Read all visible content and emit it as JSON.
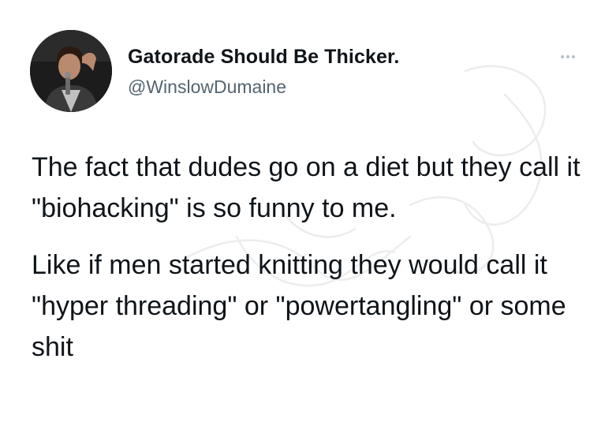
{
  "tweet": {
    "author": {
      "display_name": "Gatorade Should Be Thicker.",
      "handle": "@WinslowDumaine",
      "avatar_icon": "person-with-microphone-avatar"
    },
    "menu_icon": "more-dots-icon",
    "paragraphs": [
      "The fact that dudes go on a diet but they call it \"biohacking\" is so funny to me.",
      "Like if men started knitting they would call it \"hyper threading\" or \"powertangling\" or some shit"
    ]
  },
  "colors": {
    "text_primary": "#0f1419",
    "text_secondary": "#536471",
    "background": "#ffffff"
  }
}
